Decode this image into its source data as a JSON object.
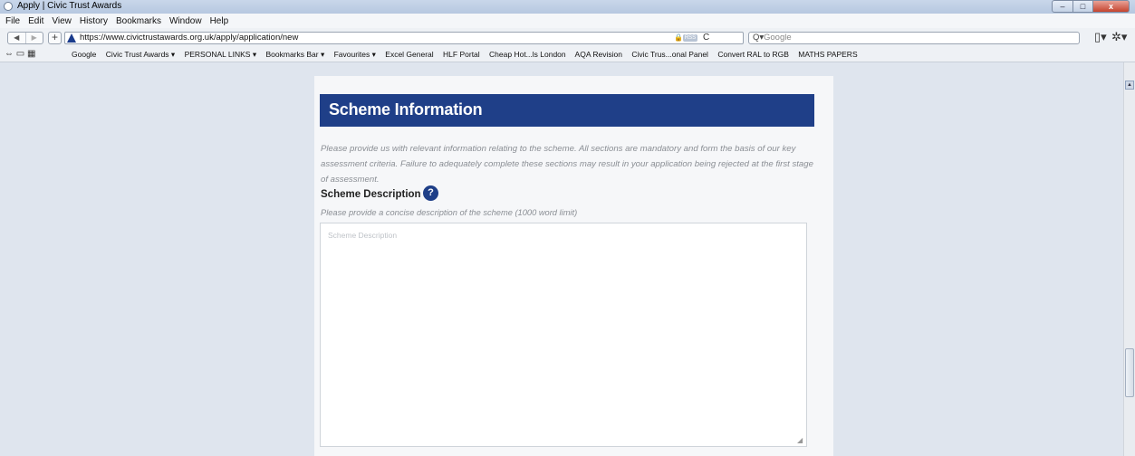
{
  "window": {
    "title": "Apply | Civic Trust Awards",
    "controls": {
      "minimize": "–",
      "maximize": "□",
      "close": "x"
    }
  },
  "menu": [
    "File",
    "Edit",
    "View",
    "History",
    "Bookmarks",
    "Window",
    "Help"
  ],
  "toolbar": {
    "back": "◀",
    "forward": "▶",
    "add": "+",
    "url": "https://www.civictrustawards.org.uk/apply/application/new",
    "rss": "RSS",
    "reload": "C",
    "search_placeholder": "Google",
    "search_icon": "Q▾",
    "page_icon": "▯▾",
    "settings_icon": "✲▾"
  },
  "bookmarks": {
    "icons": "⇔ ▭ ▦",
    "items": [
      "Google",
      "Civic Trust Awards ▾",
      "PERSONAL LINKS ▾",
      "Bookmarks Bar ▾",
      "Favourites ▾",
      "Excel General",
      "HLF Portal",
      "Cheap Hot...ls London",
      "AQA Revision",
      "Civic Trus...onal Panel",
      "Convert RAL to RGB",
      "MATHS PAPERS"
    ]
  },
  "form": {
    "header_title": "Scheme Information",
    "intro_text": "Please provide us with relevant information relating to the scheme. All sections are mandatory and form the basis of our key assessment criteria. Failure to adequately complete these sections may result in your application being rejected at the first stage of assessment.",
    "section_title": "Scheme Description",
    "help_label": "?",
    "hint": "Please provide a concise description of the scheme (1000 word limit)",
    "description_placeholder": "Scheme Description",
    "description_value": ""
  },
  "scrollbar": {
    "up_arrow": "▲"
  }
}
